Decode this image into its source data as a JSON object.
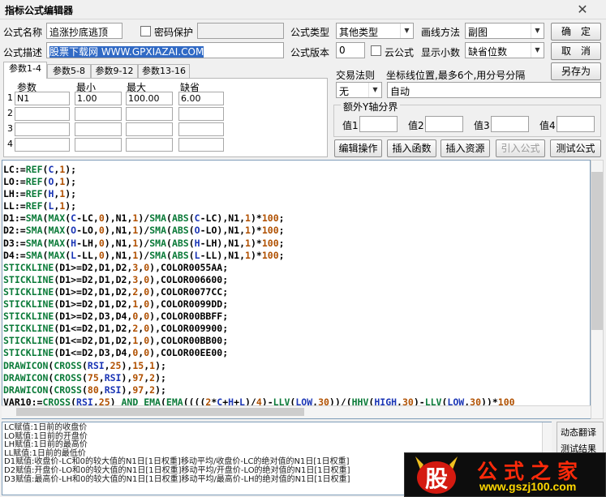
{
  "window": {
    "title": "指标公式编辑器"
  },
  "form": {
    "name_label": "公式名称",
    "name_value": "追涨抄底逃顶",
    "password_label": "密码保护",
    "desc_label": "公式描述",
    "desc_value": "股票下载网 WWW.GPXIAZAI.COM",
    "type_label": "公式类型",
    "type_value": "其他类型",
    "draw_label": "画线方法",
    "draw_value": "副图",
    "version_label": "公式版本",
    "version_value": "0",
    "cloud_label": "云公式",
    "decimals_label": "显示小数",
    "decimals_value": "缺省位数",
    "trade_rule_label": "交易法则",
    "trade_rule_value": "无",
    "coord_label": "坐标线位置,最多6个,用分号分隔",
    "coord_value": "自动",
    "y_group_title": "额外Y轴分界",
    "y_labels": [
      "值1",
      "值2",
      "值3",
      "值4"
    ]
  },
  "buttons": {
    "ok": "确　定",
    "cancel": "取　消",
    "save_as": "另存为",
    "edit_ops": "编辑操作",
    "insert_func": "插入函数",
    "insert_res": "插入资源",
    "import_formula": "引入公式",
    "test_formula": "测试公式"
  },
  "tabs": [
    "参数1-4",
    "参数5-8",
    "参数9-12",
    "参数13-16"
  ],
  "params": {
    "headers": [
      "参数",
      "最小",
      "最大",
      "缺省"
    ],
    "row_numbers": [
      "1",
      "2",
      "3",
      "4"
    ],
    "rows": [
      [
        "N1",
        "1.00",
        "100.00",
        "6.00"
      ],
      [
        "",
        "",
        "",
        ""
      ],
      [
        "",
        "",
        "",
        ""
      ],
      [
        "",
        "",
        "",
        ""
      ]
    ]
  },
  "code_lines": [
    "LC:=REF(C,1);",
    "LO:=REF(O,1);",
    "LH:=REF(H,1);",
    "LL:=REF(L,1);",
    "D1:=SMA(MAX(C-LC,0),N1,1)/SMA(ABS(C-LC),N1,1)*100;",
    "D2:=SMA(MAX(O-LO,0),N1,1)/SMA(ABS(O-LO),N1,1)*100;",
    "D3:=SMA(MAX(H-LH,0),N1,1)/SMA(ABS(H-LH),N1,1)*100;",
    "D4:=SMA(MAX(L-LL,0),N1,1)/SMA(ABS(L-LL),N1,1)*100;",
    "STICKLINE(D1>=D2,D1,D2,3,0),COLOR0055AA;",
    "STICKLINE(D1>=D2,D1,D2,3,0),COLOR006600;",
    "STICKLINE(D1>=D2,D1,D2,2,0),COLOR0077CC;",
    "STICKLINE(D1>=D2,D1,D2,1,0),COLOR0099DD;",
    "STICKLINE(D1>=D2,D3,D4,0,0),COLOR00BBFF;",
    "STICKLINE(D1<=D2,D1,D2,2,0),COLOR009900;",
    "STICKLINE(D1<=D2,D1,D2,1,0),COLOR00BB00;",
    "STICKLINE(D1<=D2,D3,D4,0,0),COLOR00EE00;",
    "DRAWICON(CROSS(RSI,25),15,1);",
    "DRAWICON(CROSS(75,RSI),97,2);",
    "DRAWICON(CROSS(80,RSI),97,2);",
    "VAR10:=CROSS(RSI,25) AND EMA(EMA((((2*C+H+L)/4)-LLV(LOW,30))/(HHV(HIGH,30)-LLV(LOW,30))*100"
  ],
  "description_lines": [
    "LC赋值:1日前的收盘价",
    "LO赋值:1日前的开盘价",
    "LH赋值:1日前的最高价",
    "LL赋值:1日前的最低价",
    "D1赋值:收盘价-LC和0的较大值的N1日[1日权重]移动平均/收盘价-LC的绝对值的N1日[1日权重]",
    "D2赋值:开盘价-LO和0的较大值的N1日[1日权重]移动平均/开盘价-LO的绝对值的N1日[1日权重]",
    "D3赋值:最高价-LH和0的较大值的N1日[1日权重]移动平均/最高价-LH的绝对值的N1日[1日权重]"
  ],
  "side_tabs": [
    "动态翻译",
    "测试结果"
  ],
  "watermark": {
    "main": "公式之家",
    "url": "www.gszj100.com",
    "logo": "股"
  },
  "colors": {
    "code_function": "#0a7a38",
    "code_number": "#b05000",
    "code_arg": "#1a35b5",
    "selection": "#316ac5"
  }
}
